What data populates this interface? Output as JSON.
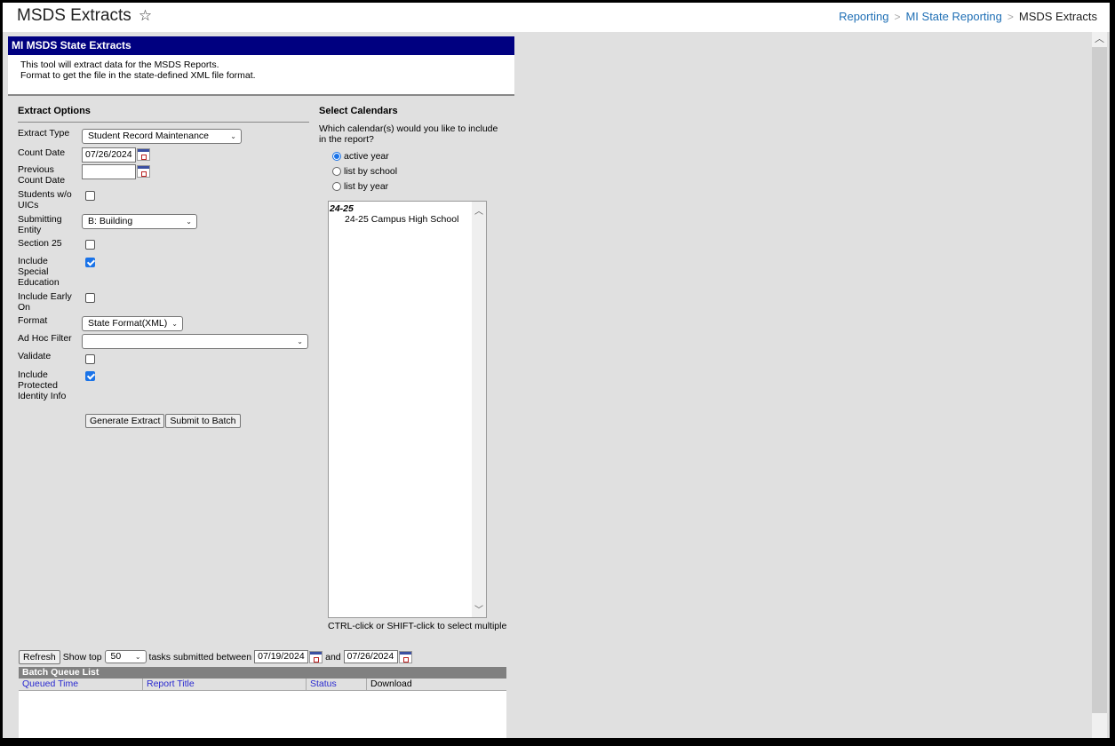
{
  "header": {
    "title": "MSDS Extracts",
    "favorite_icon": "star-outline-icon",
    "breadcrumb": [
      {
        "label": "Reporting",
        "link": true
      },
      {
        "label": "MI State Reporting",
        "link": true
      },
      {
        "label": "MSDS Extracts",
        "link": false
      }
    ]
  },
  "banner": {
    "title": "MI MSDS State Extracts",
    "intro_line1": "This tool will extract data for the MSDS Reports.",
    "intro_line2": "Format to get the file in the state-defined XML file format."
  },
  "extract_options": {
    "section_title": "Extract Options",
    "extract_type": {
      "label": "Extract Type",
      "value": "Student Record Maintenance"
    },
    "count_date": {
      "label": "Count Date",
      "value": "07/26/2024"
    },
    "previous_count_date": {
      "label_line1": "Previous",
      "label_line2": "Count Date",
      "value": ""
    },
    "students_wo_uics": {
      "label_line1": "Students w/o",
      "label_line2": "UICs",
      "checked": false
    },
    "submitting_entity": {
      "label_line1": "Submitting",
      "label_line2": "Entity",
      "value": "B: Building"
    },
    "section_25": {
      "label": "Section 25",
      "checked": false
    },
    "include_special_education": {
      "label_line1": "Include",
      "label_line2": "Special",
      "label_line3": "Education",
      "checked": true
    },
    "include_early_on": {
      "label_line1": "Include Early",
      "label_line2": "On",
      "checked": false
    },
    "format": {
      "label": "Format",
      "value": "State Format(XML)"
    },
    "ad_hoc_filter": {
      "label": "Ad Hoc Filter",
      "value": ""
    },
    "validate": {
      "label": "Validate",
      "checked": false
    },
    "include_protected_identity_info": {
      "label_line1": "Include",
      "label_line2": "Protected",
      "label_line3": "Identity Info",
      "checked": true
    },
    "generate_button": "Generate Extract",
    "submit_batch_button": "Submit to Batch"
  },
  "select_calendars": {
    "section_title": "Select Calendars",
    "question_line1": "Which calendar(s) would you like to include",
    "question_line2": "in the report?",
    "radios": [
      {
        "label": "active year",
        "selected": true
      },
      {
        "label": "list by school",
        "selected": false
      },
      {
        "label": "list by year",
        "selected": false
      }
    ],
    "list": {
      "group": "24-25",
      "options": [
        "24-25 Campus High School"
      ]
    },
    "hint": "CTRL-click or SHIFT-click to select multiple"
  },
  "batch": {
    "refresh_button": "Refresh",
    "show_top_label": "Show top",
    "show_top_value": "50",
    "between_label": "tasks submitted between",
    "start_date": "07/19/2024",
    "and_label": "and",
    "end_date": "07/26/2024",
    "queue_title": "Batch Queue List",
    "columns": [
      "Queued Time",
      "Report Title",
      "Status",
      "Download"
    ],
    "rows": []
  }
}
